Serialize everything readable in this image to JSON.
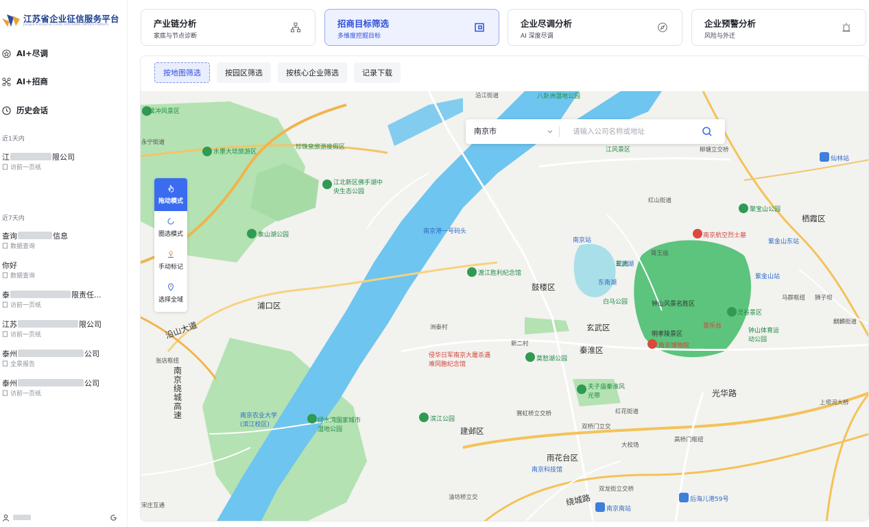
{
  "sidebar": {
    "logo_title": "江苏省企业征信服务平台",
    "logo_subtitle": "Jiangsu Enterprise Credit Information Service Platform",
    "nav": [
      {
        "label": "AI+尽调",
        "icon": "star-icon"
      },
      {
        "label": "AI+招商",
        "icon": "network-icon"
      },
      {
        "label": "历史会话",
        "icon": "clock-icon"
      }
    ],
    "recent_1d_label": "近1天内",
    "recent_7d_label": "近7天内",
    "history_1d": [
      {
        "title_prefix": "江",
        "title_suffix": "限公司",
        "sub": "访前一页纸"
      }
    ],
    "history_7d": [
      {
        "title_prefix": "查询",
        "title_suffix": "信息",
        "sub": "数据查询"
      },
      {
        "title_prefix": "你好",
        "title_suffix": "",
        "sub": "数据查询"
      },
      {
        "title_prefix": "泰",
        "title_suffix": "限责任...",
        "sub": "访前一页纸"
      },
      {
        "title_prefix": "江苏",
        "title_suffix": "限公司",
        "sub": "访前一页纸"
      },
      {
        "title_prefix": "泰州",
        "title_suffix": "公司",
        "sub": "全景报告"
      },
      {
        "title_prefix": "泰州",
        "title_suffix": "公司",
        "sub": "访前一页纸"
      }
    ]
  },
  "cards": [
    {
      "title": "产业链分析",
      "sub": "家底与节点诊断",
      "icon": "hierarchy-icon"
    },
    {
      "title": "招商目标筛选",
      "sub": "多维度挖掘目标",
      "icon": "target-box-icon"
    },
    {
      "title": "企业尽调分析",
      "sub": "AI 深度尽调",
      "icon": "compass-icon"
    },
    {
      "title": "企业预警分析",
      "sub": "风险与外迁",
      "icon": "alarm-icon"
    }
  ],
  "tabs": [
    "按地图筛选",
    "按园区筛选",
    "按核心企业筛选",
    "记录下载"
  ],
  "search": {
    "city": "南京市",
    "placeholder": "请输入公司名称或地址"
  },
  "modes": [
    {
      "label": "拖动模式",
      "icon": "hand-icon"
    },
    {
      "label": "圈选模式",
      "icon": "circle-select-icon"
    },
    {
      "label": "手动标记",
      "icon": "marker-icon"
    },
    {
      "label": "选择全域",
      "icon": "location-icon"
    }
  ],
  "map": {
    "districts": [
      "鼓楼区",
      "浦口区",
      "玄武区",
      "秦淮区",
      "建邺区",
      "雨花台区",
      "栖霞区",
      "钟山风景名胜区"
    ],
    "labels": [
      "沿江街道",
      "八卦洲湿地公园",
      "侯冲风景区",
      "永宁街道",
      "水墨大埝旅游区",
      "珍珠泉旅游度假区",
      "江北新区佛手湖中央生态公园",
      "南京港一号码头",
      "南京站",
      "玄武湖",
      "东南湖",
      "翠洲",
      "白马公园",
      "渡江胜利纪念馆",
      "南京航空烈士墓",
      "紫金山站",
      "紫金山东站",
      "聚宝山公园",
      "红山街道",
      "蒋王庙",
      "马群枢纽",
      "狮子坝",
      "麒麟街道",
      "灵谷景区",
      "钟山体育运动公园",
      "明孝陵景区",
      "音乐台",
      "南京博物院",
      "光华路",
      "上坝河大桥",
      "洲泰村",
      "侵华日军南京大屠杀遇难同胞纪念馆",
      "新二村",
      "莫愁湖公园",
      "夫子庙秦淮风光带",
      "象山湖公园",
      "沿山大道",
      "张店枢纽",
      "南京绕城高速",
      "南京农业大学(滨江校区)",
      "绿水湾国家城市湿地公园",
      "滨江公园",
      "赛虹桥立交桥",
      "双桥门立交",
      "红花街道",
      "大校场",
      "高桥门枢纽",
      "南京科技馆",
      "绕城路",
      "双龙街立交桥",
      "后海儿港59号",
      "南京南站",
      "油坊桥立交",
      "宋庄互通",
      "仙林站",
      "柳塘立交桥",
      "江风景区",
      "雨花台区"
    ]
  },
  "user": {
    "name": "",
    "avatar_icon": "user-icon"
  },
  "colors": {
    "accent": "#2f4fd8",
    "active_card_bg": "#eef2ff",
    "river": "#6ec5ef",
    "park": "#a9dfa8",
    "mode_active": "#3b6cf0"
  }
}
